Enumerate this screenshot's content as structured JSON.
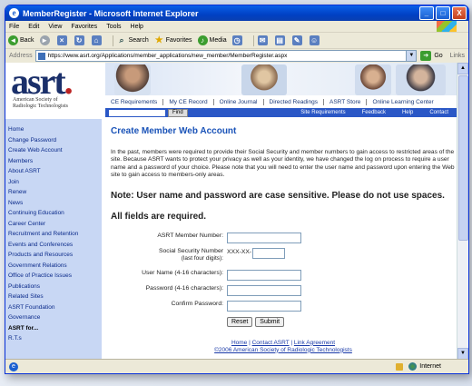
{
  "window": {
    "title": "MemberRegister - Microsoft Internet Explorer",
    "controls": [
      "_",
      "□",
      "X"
    ]
  },
  "menu": [
    "File",
    "Edit",
    "View",
    "Favorites",
    "Tools",
    "Help"
  ],
  "toolbar": {
    "back": "Back",
    "search": "Search",
    "favorites": "Favorites",
    "media": "Media"
  },
  "address": {
    "label": "Address",
    "url": "https://www.asrt.org/Applications/member_applications/new_member/MemberRegister.aspx",
    "go": "Go",
    "links": "Links"
  },
  "status": {
    "zone": "Internet"
  },
  "site": {
    "logo_text": "asrt",
    "logo_sub": [
      "American Society of",
      "Radiologic Technologists"
    ],
    "topnav": [
      "CE Requirements",
      "My CE Record",
      "Online Journal",
      "Directed Readings",
      "ASRT Store",
      "Online Learning Center"
    ],
    "find_button": "Find",
    "bluebar": [
      "Site Requirements",
      "Feedback",
      "Help",
      "Contact"
    ]
  },
  "leftnav": [
    "Home",
    "Change Password",
    "Create Web Account",
    "Members",
    "About ASRT",
    "Join",
    "Renew",
    "News",
    "Continuing Education",
    "Career Center",
    "Recruitment and Retention",
    "Events and Conferences",
    "Products and Resources",
    "Government Relations",
    "Office of Practice Issues",
    "Publications",
    "Related Sites",
    "ASRT Foundation",
    "Governance",
    "ASRT for...",
    "R.T.s"
  ],
  "main": {
    "heading": "Create Member Web Account",
    "intro": "In the past, members were required to provide their Social Security and member numbers to gain access to restricted areas of the site. Because ASRT wants to protect your privacy as well as your identity, we have changed the log on process to require a user name and a password of your choice. Please note that you will need to enter the user name and password upon entering the Web site to gain access to members-only areas.",
    "note": "Note: User name and password are case sensitive. Please do not use spaces.",
    "required": "All fields are required.",
    "fields": {
      "member_number": "ASRT Member Number:",
      "ssn": "Social Security Number",
      "ssn_sub": "(last four digits):",
      "ssn_prefix": "XXX-XX-",
      "username": "User Name (4-16 characters):",
      "password": "Password (4-16 characters):",
      "confirm": "Confirm Password:"
    },
    "reset": "Reset",
    "submit": "Submit",
    "footer_links": [
      "Home",
      "Contact ASRT",
      "Link Agreement"
    ],
    "copyright": "©2006 American Society of Radiologic Technologists"
  }
}
